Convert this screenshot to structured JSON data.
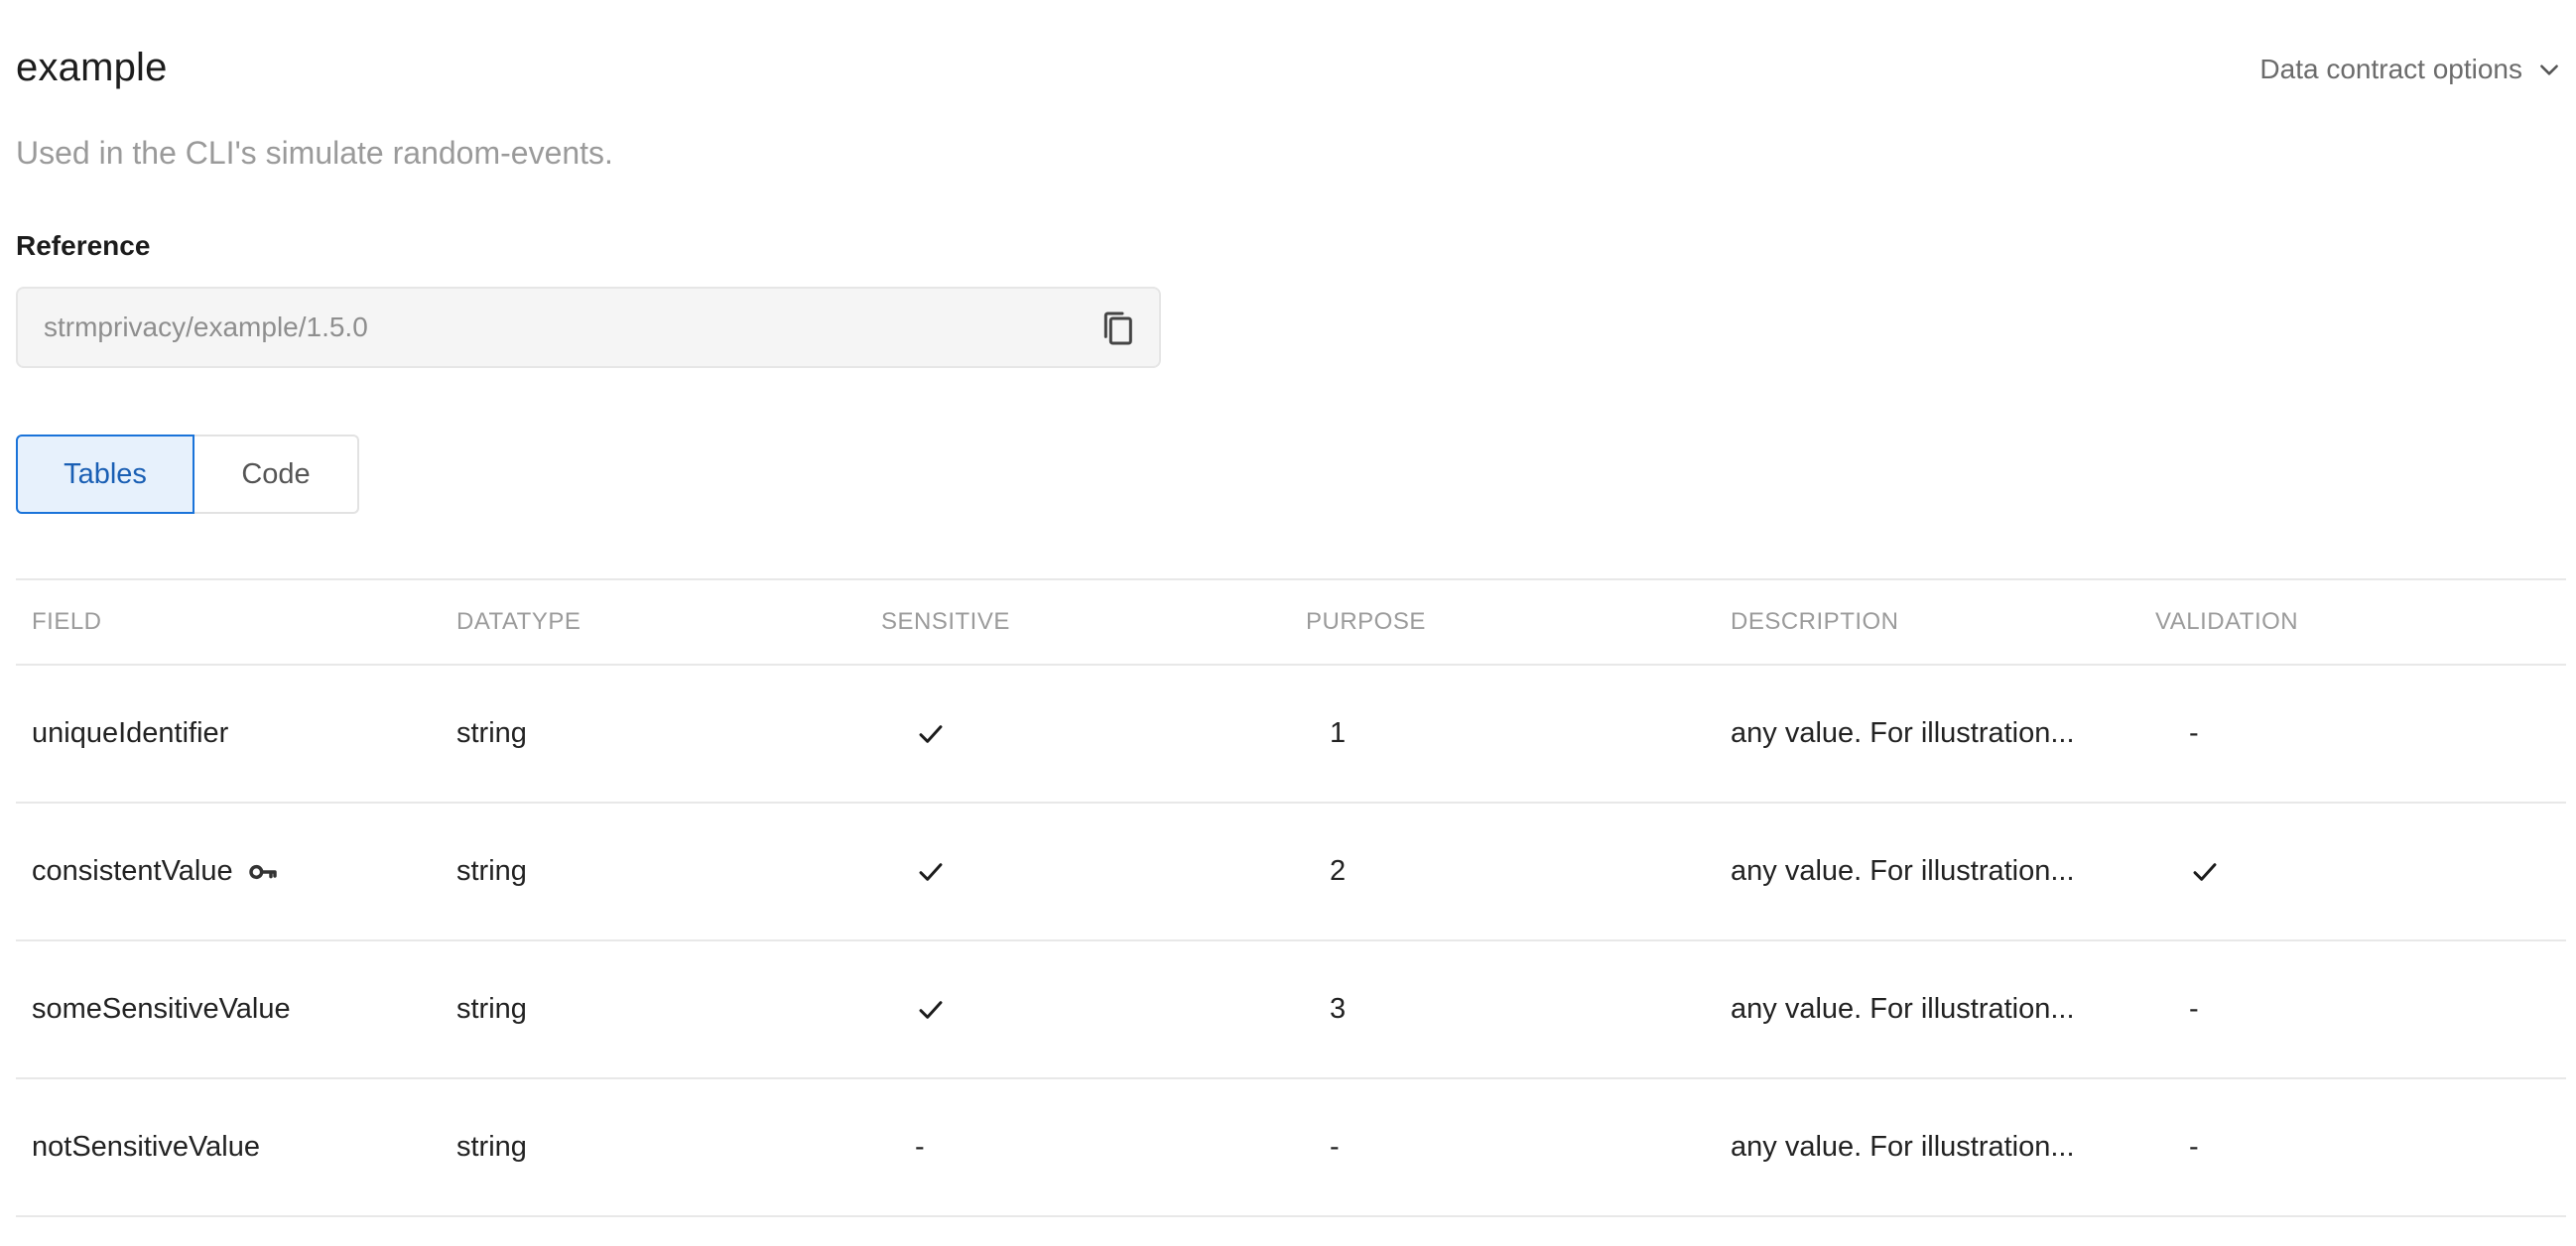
{
  "header": {
    "title": "example",
    "subtitle": "Used in the CLI's simulate random-events.",
    "options_label": "Data contract options"
  },
  "reference": {
    "label": "Reference",
    "value": "strmprivacy/example/1.5.0"
  },
  "tabs": [
    {
      "label": "Tables",
      "active": true
    },
    {
      "label": "Code",
      "active": false
    }
  ],
  "table": {
    "columns": [
      "FIELD",
      "DATATYPE",
      "SENSITIVE",
      "PURPOSE",
      "DESCRIPTION",
      "VALIDATION"
    ],
    "rows": [
      {
        "field": "uniqueIdentifier",
        "key": false,
        "datatype": "string",
        "sensitive": true,
        "purpose": "1",
        "description": "any value. For illustration...",
        "validation": "-"
      },
      {
        "field": "consistentValue",
        "key": true,
        "datatype": "string",
        "sensitive": true,
        "purpose": "2",
        "description": "any value. For illustration...",
        "validation": true
      },
      {
        "field": "someSensitiveValue",
        "key": false,
        "datatype": "string",
        "sensitive": true,
        "purpose": "3",
        "description": "any value. For illustration...",
        "validation": "-"
      },
      {
        "field": "notSensitiveValue",
        "key": false,
        "datatype": "string",
        "sensitive": "-",
        "purpose": "-",
        "description": "any value. For illustration...",
        "validation": "-"
      }
    ]
  },
  "icons": {
    "copy": "copy-icon",
    "chevron": "chevron-down-icon",
    "key": "key-icon",
    "check": "checkmark-icon"
  },
  "colors": {
    "accent": "#1a73d9",
    "accent_bg": "#e7f1fc",
    "muted_text": "#9a9a9a"
  }
}
